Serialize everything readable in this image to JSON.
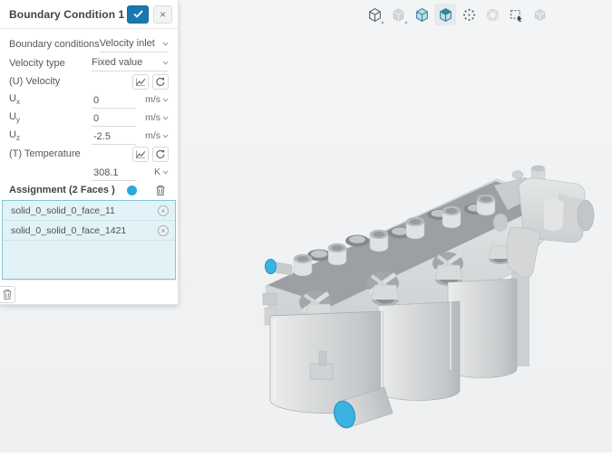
{
  "panel": {
    "title": "Boundary Condition 1",
    "icons": {
      "check": "check-icon",
      "close": "×",
      "chart": "chart-icon",
      "undo": "undo-icon",
      "trash": "trash-icon",
      "chevron": "chevron-down-icon",
      "remove": "×"
    },
    "rows": {
      "boundary_conditions": {
        "label": "Boundary conditions",
        "value": "Velocity inlet"
      },
      "velocity_type": {
        "label": "Velocity type",
        "value": "Fixed value"
      },
      "velocity_group": {
        "label": "(U) Velocity"
      },
      "ux": {
        "label": "U",
        "sub": "x",
        "value": "0",
        "unit": "m/s"
      },
      "uy": {
        "label": "U",
        "sub": "y",
        "value": "0",
        "unit": "m/s"
      },
      "uz": {
        "label": "U",
        "sub": "z",
        "value": "-2.5",
        "unit": "m/s"
      },
      "temperature_group": {
        "label": "(T) Temperature"
      },
      "temperature": {
        "value": "308.1",
        "unit": "K"
      }
    },
    "assignment": {
      "label": "Assignment (2 Faces )",
      "items": {
        "0": "solid_0_solid_0_face_11",
        "1": "solid_0_solid_0_face_1421"
      }
    }
  },
  "viewer": {
    "toolbar": {
      "0": {
        "icon": "isometric-view-icon",
        "state": "normal"
      },
      "1": {
        "icon": "shaded-cube-icon",
        "state": "disabled"
      },
      "2": {
        "icon": "volume-select-icon",
        "state": "normal"
      },
      "3": {
        "icon": "face-select-icon",
        "state": "active"
      },
      "4": {
        "icon": "vertex-select-icon",
        "state": "normal"
      },
      "5": {
        "icon": "sphere-select-icon",
        "state": "disabled"
      },
      "6": {
        "icon": "box-select-icon",
        "state": "normal"
      },
      "7": {
        "icon": "hide-part-icon",
        "state": "disabled"
      }
    },
    "model": {
      "name": "engine-block-model",
      "selected_faces": {
        "0": "solid_0_solid_0_face_11",
        "1": "solid_0_solid_0_face_1421"
      }
    }
  },
  "colors": {
    "accent_blue": "#1878b0",
    "selection_cyan": "#3ab3e2",
    "assignment_box_bg": "#e2f2f6",
    "assignment_box_border": "#7fc9d6",
    "toolbar_teal": "#2d7f93",
    "model_gray": "#d7d9da",
    "model_top_gray": "#9b9fa2",
    "background": "#f2f3f4"
  }
}
